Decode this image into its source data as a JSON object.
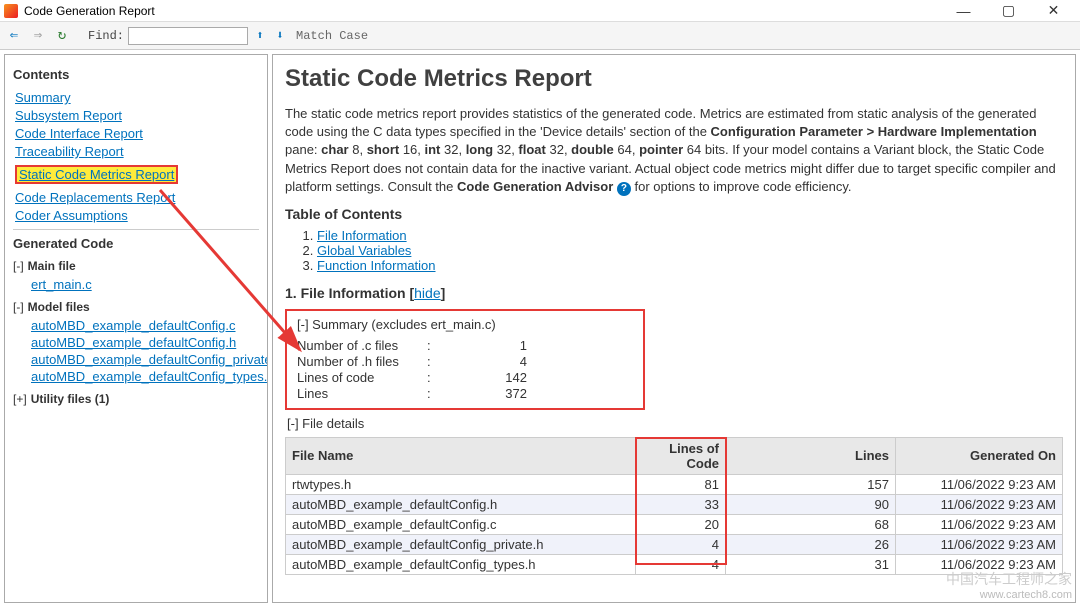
{
  "window": {
    "title": "Code Generation Report"
  },
  "toolbar": {
    "find_label": "Find:",
    "match_case": "Match Case",
    "find_value": ""
  },
  "sidebar": {
    "contents_header": "Contents",
    "nav": [
      "Summary",
      "Subsystem Report",
      "Code Interface Report",
      "Traceability Report",
      "Static Code Metrics Report",
      "Code Replacements Report",
      "Coder Assumptions"
    ],
    "generated_header": "Generated Code",
    "main_file_label": "Main file",
    "main_file": "ert_main.c",
    "model_files_label": "Model files",
    "model_files": [
      "autoMBD_example_defaultConfig.c",
      "autoMBD_example_defaultConfig.h",
      "autoMBD_example_defaultConfig_private.h",
      "autoMBD_example_defaultConfig_types.h"
    ],
    "utility_label": "Utility files (1)"
  },
  "page": {
    "title": "Static Code Metrics Report",
    "intro_1": "The static code metrics report provides statistics of the generated code. Metrics are estimated from static analysis of the generated code using the C data types specified in the 'Device details' section of the ",
    "intro_bold_1": "Configuration Parameter > Hardware Implementation",
    "intro_2": " pane: ",
    "types_text": "char 8, short 16, int 32, long 32, float 32, double 64, pointer 64 bits.",
    "intro_3": " If your model contains a Variant block, the Static Code Metrics Report does not contain data for the inactive variant. Actual object code metrics might differ due to target specific compiler and platform settings. Consult the ",
    "intro_bold_2": "Code Generation Advisor",
    "intro_4": " for options to improve code efficiency.",
    "toc_header": "Table of Contents",
    "toc": [
      "File Information",
      "Global Variables",
      "Function Information"
    ],
    "section1_title": "1. File Information",
    "hide_label": "hide",
    "summary_title": "[-] Summary (excludes ert_main.c)",
    "summary": [
      {
        "label": "Number of .c files",
        "sep": ":",
        "val": "1"
      },
      {
        "label": "Number of .h files",
        "sep": ":",
        "val": "4"
      },
      {
        "label": "Lines of code",
        "sep": ":",
        "val": "142"
      },
      {
        "label": "Lines",
        "sep": ":",
        "val": "372"
      }
    ],
    "file_details_label": "[-] File details",
    "table": {
      "headers": [
        "File Name",
        "Lines of Code",
        "Lines",
        "Generated On"
      ],
      "rows": [
        [
          "rtwtypes.h",
          "81",
          "157",
          "11/06/2022 9:23 AM"
        ],
        [
          "autoMBD_example_defaultConfig.h",
          "33",
          "90",
          "11/06/2022 9:23 AM"
        ],
        [
          "autoMBD_example_defaultConfig.c",
          "20",
          "68",
          "11/06/2022 9:23 AM"
        ],
        [
          "autoMBD_example_defaultConfig_private.h",
          "4",
          "26",
          "11/06/2022 9:23 AM"
        ],
        [
          "autoMBD_example_defaultConfig_types.h",
          "4",
          "31",
          "11/06/2022 9:23 AM"
        ]
      ]
    }
  },
  "watermark": {
    "line1": "中国汽车工程师之家",
    "line2": "www.cartech8.com"
  }
}
